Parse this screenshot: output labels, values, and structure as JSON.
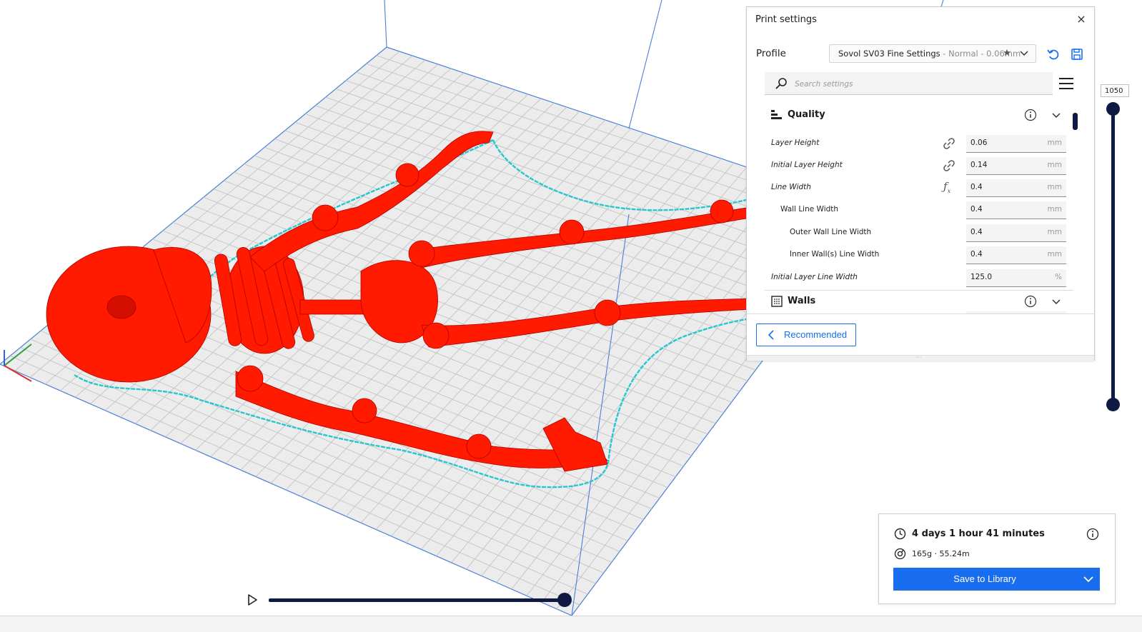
{
  "print_settings": {
    "title": "Print settings",
    "close_symbol": "×",
    "profile_label": "Profile",
    "profile_name": "Sovol SV03 Fine Settings",
    "profile_subtitle": " - Normal - 0.06mm",
    "search_placeholder": "Search settings",
    "sections": [
      {
        "title": "Quality",
        "icon": "quality-icon"
      },
      {
        "title": "Walls",
        "icon": "walls-icon"
      }
    ],
    "settings": [
      {
        "label": "Layer Height",
        "value": "0.06",
        "unit": "mm",
        "icon": "link-icon"
      },
      {
        "label": "Initial Layer Height",
        "value": "0.14",
        "unit": "mm",
        "icon": "link-icon"
      },
      {
        "label": "Line Width",
        "value": "0.4",
        "unit": "mm",
        "icon": "function-icon"
      },
      {
        "label": "Wall Line Width",
        "value": "0.4",
        "unit": "mm"
      },
      {
        "label": "Outer Wall Line Width",
        "value": "0.4",
        "unit": "mm"
      },
      {
        "label": "Inner Wall(s) Line Width",
        "value": "0.4",
        "unit": "mm"
      },
      {
        "label": "Initial Layer Line Width",
        "value": "125.0",
        "unit": "%"
      }
    ],
    "recommended_label": "Recommended"
  },
  "layer_slider": {
    "current_layer": "1050"
  },
  "estimate": {
    "print_time": "4 days 1 hour 41 minutes",
    "material_usage": "165g · 55.24m",
    "save_button_label": "Save to Library"
  },
  "playback": {
    "progress": 1.0
  },
  "colors": {
    "accent": "#196ef0",
    "slider": "#0f1a44",
    "model": "#ff1a00",
    "skirt": "#27c7cf",
    "plate_grid": "#cfcfcf"
  }
}
